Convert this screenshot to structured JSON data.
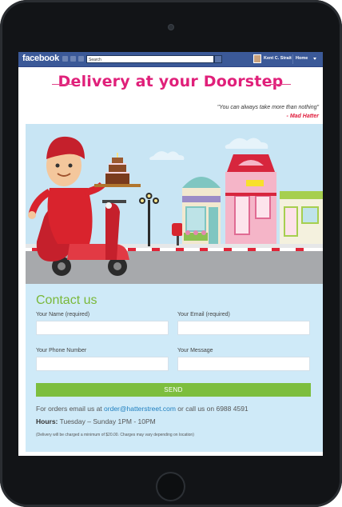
{
  "facebook": {
    "logo": "facebook",
    "search_placeholder": "Search",
    "user_name": "Kent C. Strait",
    "home_label": "Home"
  },
  "page": {
    "headline": "Delivery at your Doorstep",
    "quote": "\"You can always take more than nothing\"",
    "quote_author": "- Mad Hatter"
  },
  "contact": {
    "title": "Contact us",
    "name_label": "Your Name (required)",
    "email_label": "Your Email (required)",
    "phone_label": "Your Phone Number",
    "message_label": "Your Message",
    "send_label": "SEND",
    "orders_prefix": "For orders email us at ",
    "orders_email": "order@hatterstreet.com",
    "orders_suffix": " or call us on 6988 4591",
    "hours_label": "Hours:",
    "hours_value": " Tuesday – Sunday 1PM - 10PM",
    "note": "(Delivery will be charged a minimum of $20.00. Charges may vary depending on location)"
  },
  "colors": {
    "facebook_blue": "#3b5998",
    "headline_pink": "#e0207a",
    "accent_green": "#7dbe3e",
    "link_blue": "#1f7fbf"
  }
}
